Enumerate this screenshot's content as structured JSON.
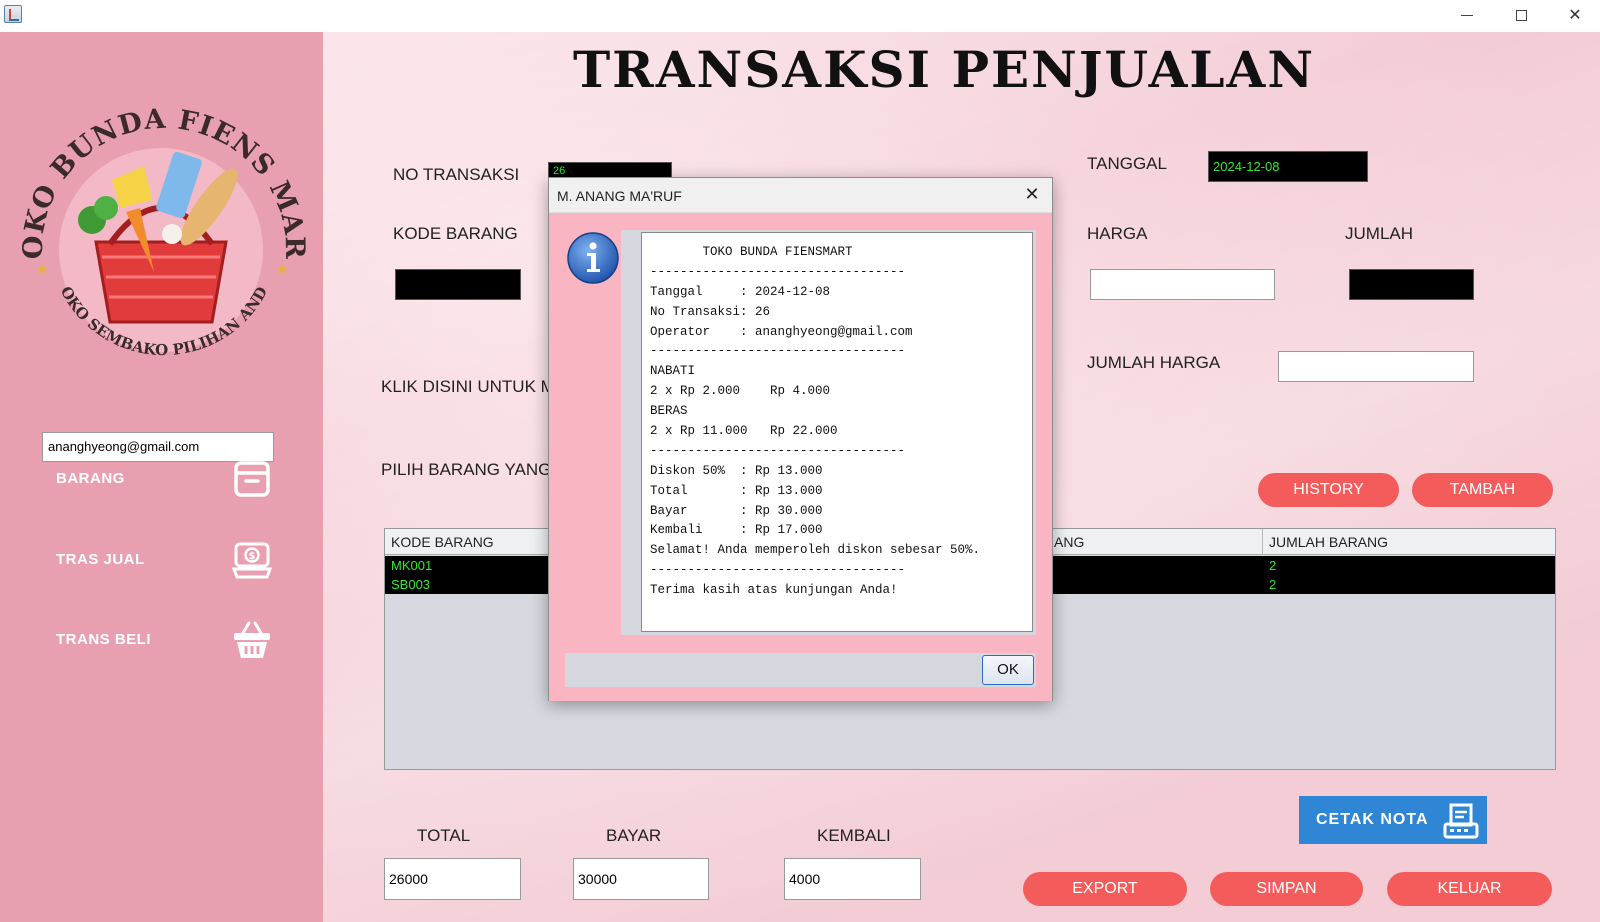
{
  "window": {
    "controls": {
      "minimize": "–",
      "maximize": "□",
      "close": "✕"
    }
  },
  "sidebar": {
    "logo": {
      "top_text": "TOKO BUNDA FIENS MART",
      "bottom_text": "TOKO SEMBAKO PILIHAN ANDA"
    },
    "user_email": "ananghyeong@gmail.com",
    "nav": [
      {
        "label": "BARANG",
        "icon": "box-icon"
      },
      {
        "label": "TRAS JUAL",
        "icon": "cash-register-icon"
      },
      {
        "label": "TRANS BELI",
        "icon": "basket-icon"
      }
    ]
  },
  "main": {
    "title": "TRANSAKSI PENJUALAN",
    "labels": {
      "no_transaksi": "NO TRANSAKSI",
      "kode_barang": "KODE BARANG",
      "klik_disini": "KLIK DISINI UNTUK M",
      "pilih_barang": "PILIH BARANG YANG",
      "tanggal": "TANGGAL",
      "harga": "HARGA",
      "jumlah": "JUMLAH",
      "jumlah_harga": "JUMLAH HARGA",
      "total": "TOTAL",
      "bayar": "BAYAR",
      "kembali": "KEMBALI"
    },
    "fields": {
      "no_transaksi": "26",
      "tanggal": "2024-12-08",
      "harga": "",
      "jumlah": "",
      "jumlah_harga": "",
      "kode_barang": "",
      "total": "26000",
      "bayar": "30000",
      "kembali": "4000"
    },
    "buttons": {
      "history": "HISTORY",
      "tambah": "TAMBAH",
      "cetak_nota": "CETAK NOTA",
      "export": "EXPORT",
      "simpan": "SIMPAN",
      "keluar": "KELUAR"
    },
    "table": {
      "columns": [
        "KODE BARANG",
        "ANG",
        "JUMLAH BARANG"
      ],
      "rows": [
        {
          "kode": "MK001",
          "jumlah": "2"
        },
        {
          "kode": "SB003",
          "jumlah": "2"
        }
      ]
    }
  },
  "dialog": {
    "title": "M. ANANG MA'RUF",
    "close": "✕",
    "ok_label": "OK",
    "lines": [
      "       TOKO BUNDA FIENSMART",
      "----------------------------------",
      "Tanggal     : 2024-12-08",
      "No Transaksi: 26",
      "Operator    : ananghyeong@gmail.com",
      "----------------------------------",
      "NABATI",
      "2 x Rp 2.000    Rp 4.000",
      "BERAS",
      "2 x Rp 11.000   Rp 22.000",
      "----------------------------------",
      "Diskon 50%  : Rp 13.000",
      "Total       : Rp 13.000",
      "Bayar       : Rp 30.000",
      "Kembali     : Rp 17.000",
      "Selamat! Anda memperoleh diskon sebesar 50%.",
      "----------------------------------",
      "Terima kasih atas kunjungan Anda!"
    ]
  },
  "colors": {
    "sidebar_bg": "#e8a0b0",
    "accent_button": "#f45c5c",
    "cetak_button": "#2f86d4",
    "dialog_body": "#f9b6c2",
    "field_green_text": "#31e831"
  }
}
